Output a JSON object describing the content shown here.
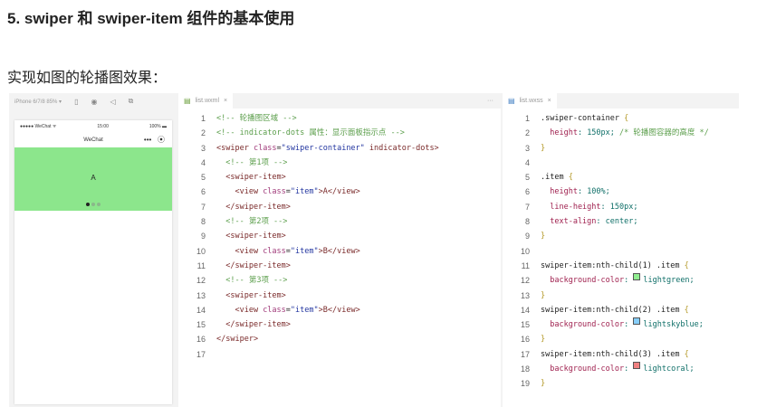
{
  "title": "5. swiper 和 swiper-item 组件的基本使用",
  "subtitle": "实现如图的轮播图效果：",
  "simulator": {
    "device": "iPhone 6/7/8 85% ▾",
    "carrier": "●●●●● WeChat ᯤ",
    "time": "15:00",
    "battery": "100% ▬",
    "nav_title": "WeChat",
    "nav_menu": "•••",
    "nav_close": "⦿",
    "slide_text": "A"
  },
  "editor1": {
    "tab": "list.wxml",
    "close": "×",
    "more": "···",
    "lines": [
      [
        [
          "<!-- 轮播图区域 -->",
          "c"
        ]
      ],
      [
        [
          "<!-- indicator-dots 属性：显示面板指示点 -->",
          "c"
        ]
      ],
      [
        [
          "<swiper ",
          "t"
        ],
        [
          "class",
          "a"
        ],
        [
          "=",
          "p"
        ],
        [
          "\"swiper-container\"",
          "s"
        ],
        [
          " indicator-dots>",
          "t"
        ]
      ],
      [
        [
          "  <!-- 第1项 -->",
          "c"
        ]
      ],
      [
        [
          "  <swiper-item>",
          "t"
        ]
      ],
      [
        [
          "    <view ",
          "t"
        ],
        [
          "class",
          "a"
        ],
        [
          "=",
          "p"
        ],
        [
          "\"item\"",
          "s"
        ],
        [
          ">A</view>",
          "t"
        ]
      ],
      [
        [
          "  </swiper-item>",
          "t"
        ]
      ],
      [
        [
          "  <!-- 第2项 -->",
          "c"
        ]
      ],
      [
        [
          "  <swiper-item>",
          "t"
        ]
      ],
      [
        [
          "    <view ",
          "t"
        ],
        [
          "class",
          "a"
        ],
        [
          "=",
          "p"
        ],
        [
          "\"item\"",
          "s"
        ],
        [
          ">B</view>",
          "t"
        ]
      ],
      [
        [
          "  </swiper-item>",
          "t"
        ]
      ],
      [
        [
          "  <!-- 第3项 -->",
          "c"
        ]
      ],
      [
        [
          "  <swiper-item>",
          "t"
        ]
      ],
      [
        [
          "    <view ",
          "t"
        ],
        [
          "class",
          "a"
        ],
        [
          "=",
          "p"
        ],
        [
          "\"item\"",
          "s"
        ],
        [
          ">B</view>",
          "t"
        ]
      ],
      [
        [
          "  </swiper-item>",
          "t"
        ]
      ],
      [
        [
          "</swiper>",
          "t"
        ]
      ],
      [
        [
          "",
          ""
        ]
      ]
    ]
  },
  "editor2": {
    "tab": "list.wxss",
    "close": "×",
    "lines": [
      [
        [
          ".swiper-container ",
          "p"
        ],
        [
          "{",
          "b"
        ]
      ],
      [
        [
          "  height",
          "pr"
        ],
        [
          ": 150px; ",
          "v"
        ],
        [
          "/* 轮播图容器的高度 */",
          "c"
        ]
      ],
      [
        [
          "}",
          "b"
        ]
      ],
      [
        [
          "",
          ""
        ]
      ],
      [
        [
          ".item ",
          "p"
        ],
        [
          "{",
          "b"
        ]
      ],
      [
        [
          "  height",
          "pr"
        ],
        [
          ": 100%;",
          "v"
        ]
      ],
      [
        [
          "  line-height",
          "pr"
        ],
        [
          ": 150px;",
          "v"
        ]
      ],
      [
        [
          "  text-align",
          "pr"
        ],
        [
          ": center;",
          "v"
        ]
      ],
      [
        [
          "}",
          "b"
        ]
      ],
      [
        [
          "",
          ""
        ]
      ],
      [
        [
          "swiper-item:nth-child(1) .item ",
          "p"
        ],
        [
          "{",
          "b"
        ]
      ],
      [
        [
          "  background-color",
          "pr"
        ],
        [
          ": ",
          "v"
        ],
        [
          "#90ee90",
          "sw"
        ],
        [
          "lightgreen;",
          "v"
        ]
      ],
      [
        [
          "}",
          "b"
        ]
      ],
      [
        [
          "swiper-item:nth-child(2) .item ",
          "p"
        ],
        [
          "{",
          "b"
        ]
      ],
      [
        [
          "  background-color",
          "pr"
        ],
        [
          ": ",
          "v"
        ],
        [
          "#87cefa",
          "sw"
        ],
        [
          "lightskyblue;",
          "v"
        ]
      ],
      [
        [
          "}",
          "b"
        ]
      ],
      [
        [
          "swiper-item:nth-child(3) .item ",
          "p"
        ],
        [
          "{",
          "b"
        ]
      ],
      [
        [
          "  background-color",
          "pr"
        ],
        [
          ": ",
          "v"
        ],
        [
          "#f08080",
          "sw"
        ],
        [
          "lightcoral;",
          "v"
        ]
      ],
      [
        [
          "}",
          "b"
        ]
      ]
    ]
  }
}
